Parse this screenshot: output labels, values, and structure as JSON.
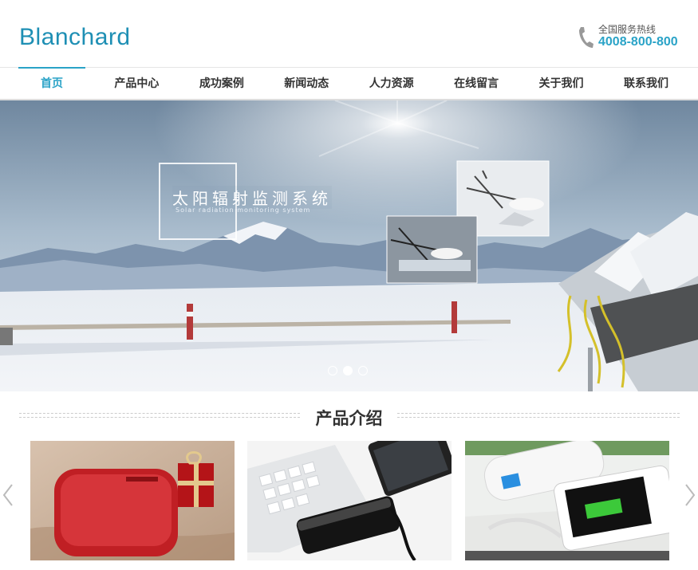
{
  "header": {
    "logo_text": "Blanchard",
    "hotline_label": "全国服务热线",
    "hotline_number": "4008-800-800"
  },
  "nav": {
    "items": [
      {
        "label": "首页",
        "active": true
      },
      {
        "label": "产品中心",
        "active": false
      },
      {
        "label": "成功案例",
        "active": false
      },
      {
        "label": "新闻动态",
        "active": false
      },
      {
        "label": "人力资源",
        "active": false
      },
      {
        "label": "在线留言",
        "active": false
      },
      {
        "label": "关于我们",
        "active": false
      },
      {
        "label": "联系我们",
        "active": false
      }
    ]
  },
  "banner": {
    "title": "太阳辐射监测系统",
    "subtitle": "Solar radiation monitoring system",
    "slide_count": 3,
    "active_slide": 2
  },
  "products_section": {
    "title": "产品介绍",
    "items": [
      {
        "image": "red-power-bank"
      },
      {
        "image": "black-power-bank-keyboard-tablet"
      },
      {
        "image": "white-power-bank-phone"
      }
    ]
  },
  "colors": {
    "accent": "#2aa3c7",
    "logo": "#1e8fb4"
  },
  "icons": [
    "phone-icon",
    "chevron-left-icon",
    "chevron-right-icon"
  ]
}
